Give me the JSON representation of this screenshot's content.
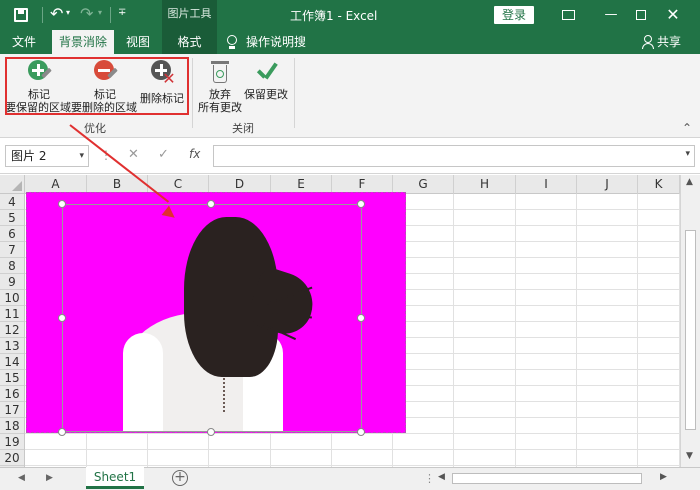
{
  "titlebar": {
    "context_tools": "图片工具",
    "document_title": "工作簿1  -  Excel",
    "login": "登录",
    "close": "✕",
    "minimize": "—",
    "undo": "↶",
    "redo": "↷",
    "dropdown": "▾",
    "qat_more": "∓"
  },
  "tabs": {
    "file": "文件",
    "bg_remove": "背景消除",
    "view": "视图",
    "format": "格式",
    "tell_me": "操作说明搜索",
    "share": "共享"
  },
  "ribbon": {
    "mark_keep_line1": "标记",
    "mark_keep_line2": "要保留的区域",
    "mark_remove_line1": "标记",
    "mark_remove_line2": "要删除的区域",
    "delete_mark": "删除标记",
    "group_optimize": "优化",
    "discard_line1": "放弃",
    "discard_line2": "所有更改",
    "keep_changes": "保留更改",
    "group_close": "关闭",
    "collapse": "⌃"
  },
  "formula_bar": {
    "name_box": "图片 2",
    "dots": "⋮",
    "cancel": "✕",
    "enter": "✓",
    "fx": "fx",
    "dropdown": "▾"
  },
  "grid": {
    "columns": [
      "A",
      "B",
      "C",
      "D",
      "E",
      "F",
      "G",
      "H",
      "I",
      "J",
      "K"
    ],
    "rows": [
      "4",
      "5",
      "6",
      "7",
      "8",
      "9",
      "10",
      "11",
      "12",
      "13",
      "14",
      "15",
      "16",
      "17",
      "18",
      "19",
      "20"
    ]
  },
  "scroll": {
    "up": "▲",
    "down": "▼",
    "left": "◀",
    "right": "▶",
    "dots": "⋮"
  },
  "sheets": {
    "active": "Sheet1",
    "nav_prev": "◀",
    "nav_next": "▶",
    "add": "+"
  },
  "colors": {
    "excel_green": "#217346",
    "removal_magenta": "#ff00ff",
    "highlight_red": "#e03030"
  }
}
